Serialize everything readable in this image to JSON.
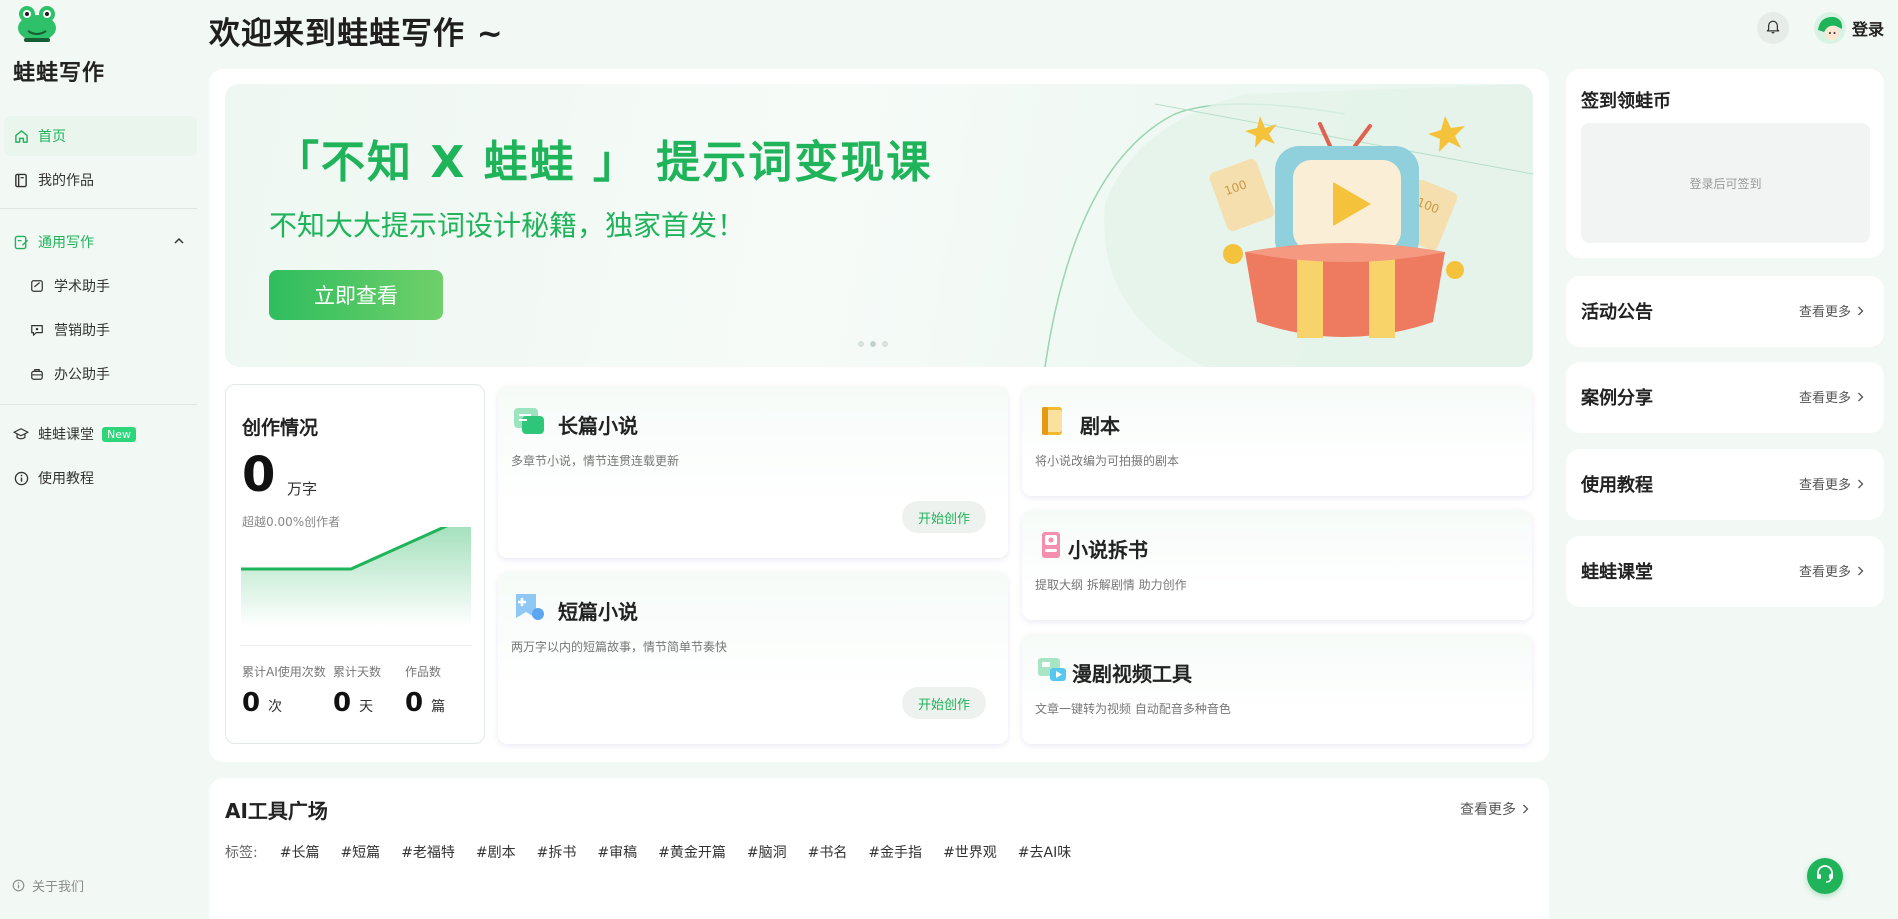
{
  "app": {
    "brand": "蛙蛙写作",
    "page_title": "欢迎来到蛙蛙写作 ~",
    "login_label": "登录"
  },
  "sidebar": {
    "items": [
      {
        "label": "首页",
        "icon": "home-icon",
        "active": true
      },
      {
        "label": "我的作品",
        "icon": "book-icon"
      },
      {
        "label": "通用写作",
        "icon": "edit-icon",
        "expanded": true
      },
      {
        "label": "学术助手",
        "icon": "academic-icon"
      },
      {
        "label": "营销助手",
        "icon": "marketing-icon"
      },
      {
        "label": "办公助手",
        "icon": "office-icon"
      },
      {
        "label": "蛙蛙课堂",
        "icon": "graduation-cap-icon",
        "badge": "New"
      },
      {
        "label": "使用教程",
        "icon": "info-icon"
      }
    ],
    "about": "关于我们"
  },
  "banner": {
    "title": "「不知 X 蛙蛙 」 提示词变现课",
    "subtitle": "不知大大提示词设计秘籍，独家首发！",
    "button": "立即查看"
  },
  "stats": {
    "title": "创作情况",
    "words": "0",
    "words_unit": "万字",
    "rank_text": "超越0.00%创作者",
    "metrics": [
      {
        "label": "累计AI使用次数",
        "value": "0",
        "unit": "次"
      },
      {
        "label": "累计天数",
        "value": "0",
        "unit": "天"
      },
      {
        "label": "作品数",
        "value": "0",
        "unit": "篇"
      }
    ]
  },
  "tools": [
    {
      "title": "长篇小说",
      "desc": "多章节小说，情节连贯连载更新",
      "button": "开始创作"
    },
    {
      "title": "短篇小说",
      "desc": "两万字以内的短篇故事，情节简单节奏快",
      "button": "开始创作"
    },
    {
      "title": "剧本",
      "desc": "将小说改编为可拍摄的剧本"
    },
    {
      "title": "小说拆书",
      "desc": "提取大纲 拆解剧情 助力创作"
    },
    {
      "title": "漫剧视频工具",
      "desc": "文章一键转为视频 自动配音多种音色"
    }
  ],
  "right": {
    "checkin_title": "签到领蛙币",
    "checkin_hint": "登录后可签到",
    "more_label": "查看更多",
    "cards": [
      "活动公告",
      "案例分享",
      "使用教程",
      "蛙蛙课堂"
    ]
  },
  "ai_tools": {
    "title": "AI工具广场",
    "more": "查看更多",
    "tag_label": "标签:",
    "tags": [
      "#长篇",
      "#短篇",
      "#老福特",
      "#剧本",
      "#拆书",
      "#审稿",
      "#黄金开篇",
      "#脑洞",
      "#书名",
      "#金手指",
      "#世界观",
      "#去AI味"
    ]
  },
  "colors": {
    "accent": "#1fb35a",
    "background": "#f2f8f4"
  }
}
